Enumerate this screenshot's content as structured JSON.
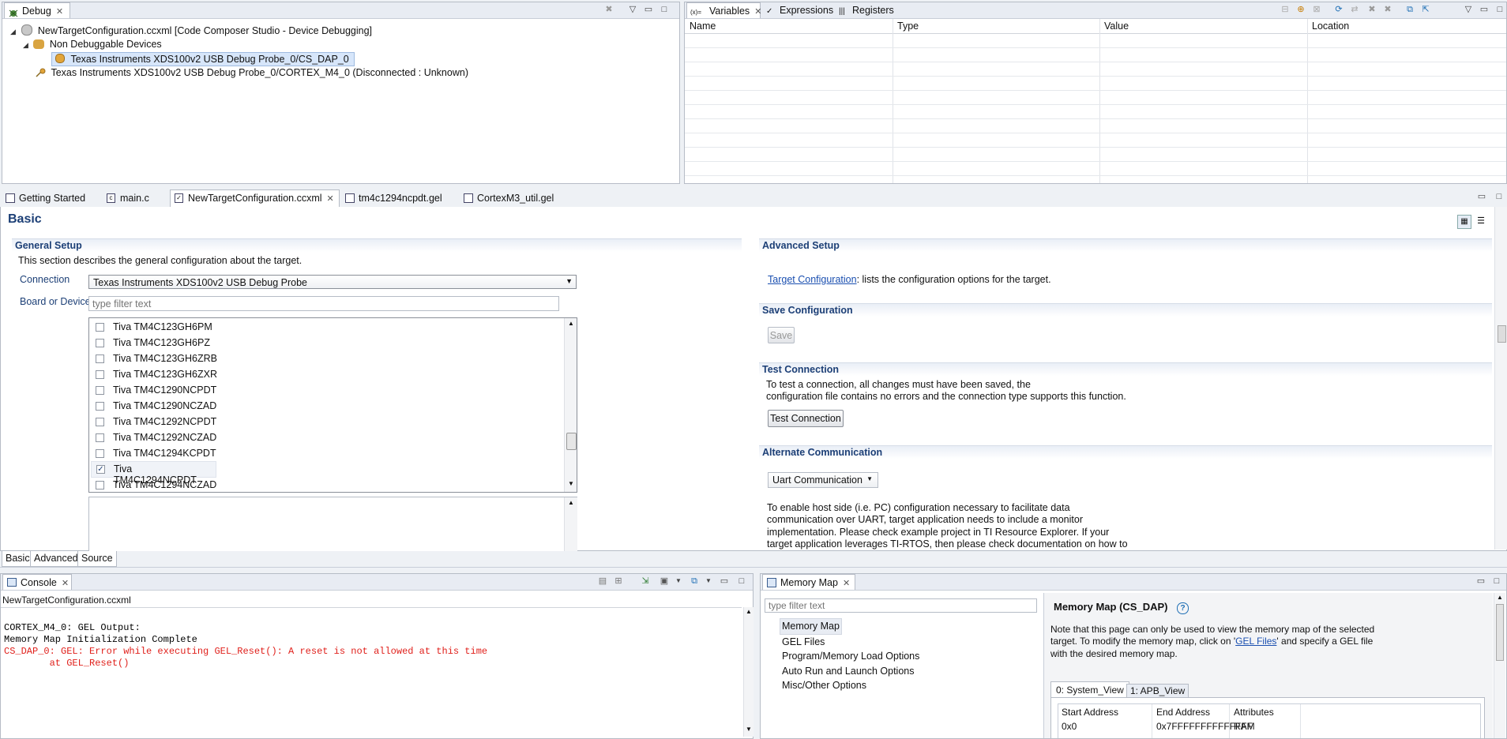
{
  "debug_view": {
    "tab_label": "Debug",
    "tree": [
      {
        "label": "NewTargetConfiguration.ccxml [Code Composer Studio - Device Debugging]"
      },
      {
        "label": "Non Debuggable Devices"
      },
      {
        "label": "Texas Instruments XDS100v2 USB Debug Probe_0/CS_DAP_0"
      },
      {
        "label": "Texas Instruments XDS100v2 USB Debug Probe_0/CORTEX_M4_0 (Disconnected : Unknown)"
      }
    ]
  },
  "variables_view": {
    "tabs": [
      {
        "label": "Variables",
        "icon": "variables-icon"
      },
      {
        "label": "Expressions",
        "icon": "expressions-icon"
      },
      {
        "label": "Registers",
        "icon": "registers-icon"
      }
    ],
    "columns": [
      "Name",
      "Type",
      "Value",
      "Location"
    ]
  },
  "editor": {
    "tabs": [
      {
        "label": "Getting Started"
      },
      {
        "label": "main.c"
      },
      {
        "label": "NewTargetConfiguration.ccxml"
      },
      {
        "label": "tm4c1294ncpdt.gel"
      },
      {
        "label": "CortexM3_util.gel"
      }
    ],
    "title": "Basic",
    "general_setup": {
      "heading": "General Setup",
      "description": "This section describes the general configuration about the target.",
      "connection_label": "Connection",
      "connection_value": "Texas Instruments XDS100v2 USB Debug Probe",
      "board_label": "Board or Device",
      "filter_placeholder": "type filter text",
      "devices": [
        {
          "label": "Tiva TM4C123GH6PM",
          "checked": false
        },
        {
          "label": "Tiva TM4C123GH6PZ",
          "checked": false
        },
        {
          "label": "Tiva TM4C123GH6ZRB",
          "checked": false
        },
        {
          "label": "Tiva TM4C123GH6ZXR",
          "checked": false
        },
        {
          "label": "Tiva TM4C1290NCPDT",
          "checked": false
        },
        {
          "label": "Tiva TM4C1290NCZAD",
          "checked": false
        },
        {
          "label": "Tiva TM4C1292NCPDT",
          "checked": false
        },
        {
          "label": "Tiva TM4C1292NCZAD",
          "checked": false
        },
        {
          "label": "Tiva TM4C1294KCPDT",
          "checked": false
        },
        {
          "label": "Tiva TM4C1294NCPDT",
          "checked": true
        },
        {
          "label": "Tiva TM4C1294NCZAD",
          "checked": false
        }
      ]
    },
    "advanced_setup": {
      "heading": "Advanced Setup",
      "link": "Target Configuration",
      "link_suffix": ": lists the configuration options for the target."
    },
    "save_configuration": {
      "heading": "Save Configuration",
      "button": "Save"
    },
    "test_connection": {
      "heading": "Test Connection",
      "line1": "To test a connection, all changes must have been saved, the",
      "line2": "configuration file contains no errors and the connection type supports this function.",
      "button": "Test Connection"
    },
    "alternate_communication": {
      "heading": "Alternate Communication",
      "select_value": "Uart Communication",
      "text_lines": [
        "To enable host side (i.e. PC) configuration necessary to facilitate data",
        "communication over UART, target application needs to include a monitor",
        "implementation. Please check example project in TI Resource Explorer. If your",
        "target application leverages TI-RTOS, then please check documentation on how to"
      ]
    },
    "bottom_tabs": [
      "Basic",
      "Advanced",
      "Source"
    ]
  },
  "console": {
    "tab_label": "Console",
    "subtitle": "NewTargetConfiguration.ccxml",
    "lines": [
      {
        "text": "CORTEX_M4_0: GEL Output:",
        "color": "#000000"
      },
      {
        "text": "Memory Map Initialization Complete",
        "color": "#000000"
      },
      {
        "text": "CS_DAP_0: GEL: Error while executing GEL_Reset(): A reset is not allowed at this time",
        "color": "#e0201b"
      },
      {
        "text": "        at GEL_Reset()",
        "color": "#e0201b"
      }
    ]
  },
  "memory_map": {
    "tab_label": "Memory Map",
    "filter_placeholder": "type filter text",
    "nav_items": [
      "Memory Map",
      "GEL Files",
      "Program/Memory Load Options",
      "Auto Run and Launch Options",
      "Misc/Other Options"
    ],
    "title": "Memory Map (CS_DAP)",
    "note_lines": [
      "Note that this page can only be used to view the memory map of the selected",
      "target.  To modify the memory map, click on '",
      "' and specify a GEL file",
      "with the desired memory map."
    ],
    "note_link": "GEL Files",
    "view_tabs": [
      "0: System_View",
      "1: APB_View"
    ],
    "table_columns": [
      "Start Address",
      "End Address",
      "Attributes"
    ],
    "table_partial_row": [
      "0x0",
      "0x7FFFFFFFFFFFFFF",
      "RAM"
    ]
  },
  "colors": {
    "accent": "#1c3f76",
    "link": "#1a4fb0",
    "error": "#e0201b",
    "selection": "#d7e6fa"
  }
}
